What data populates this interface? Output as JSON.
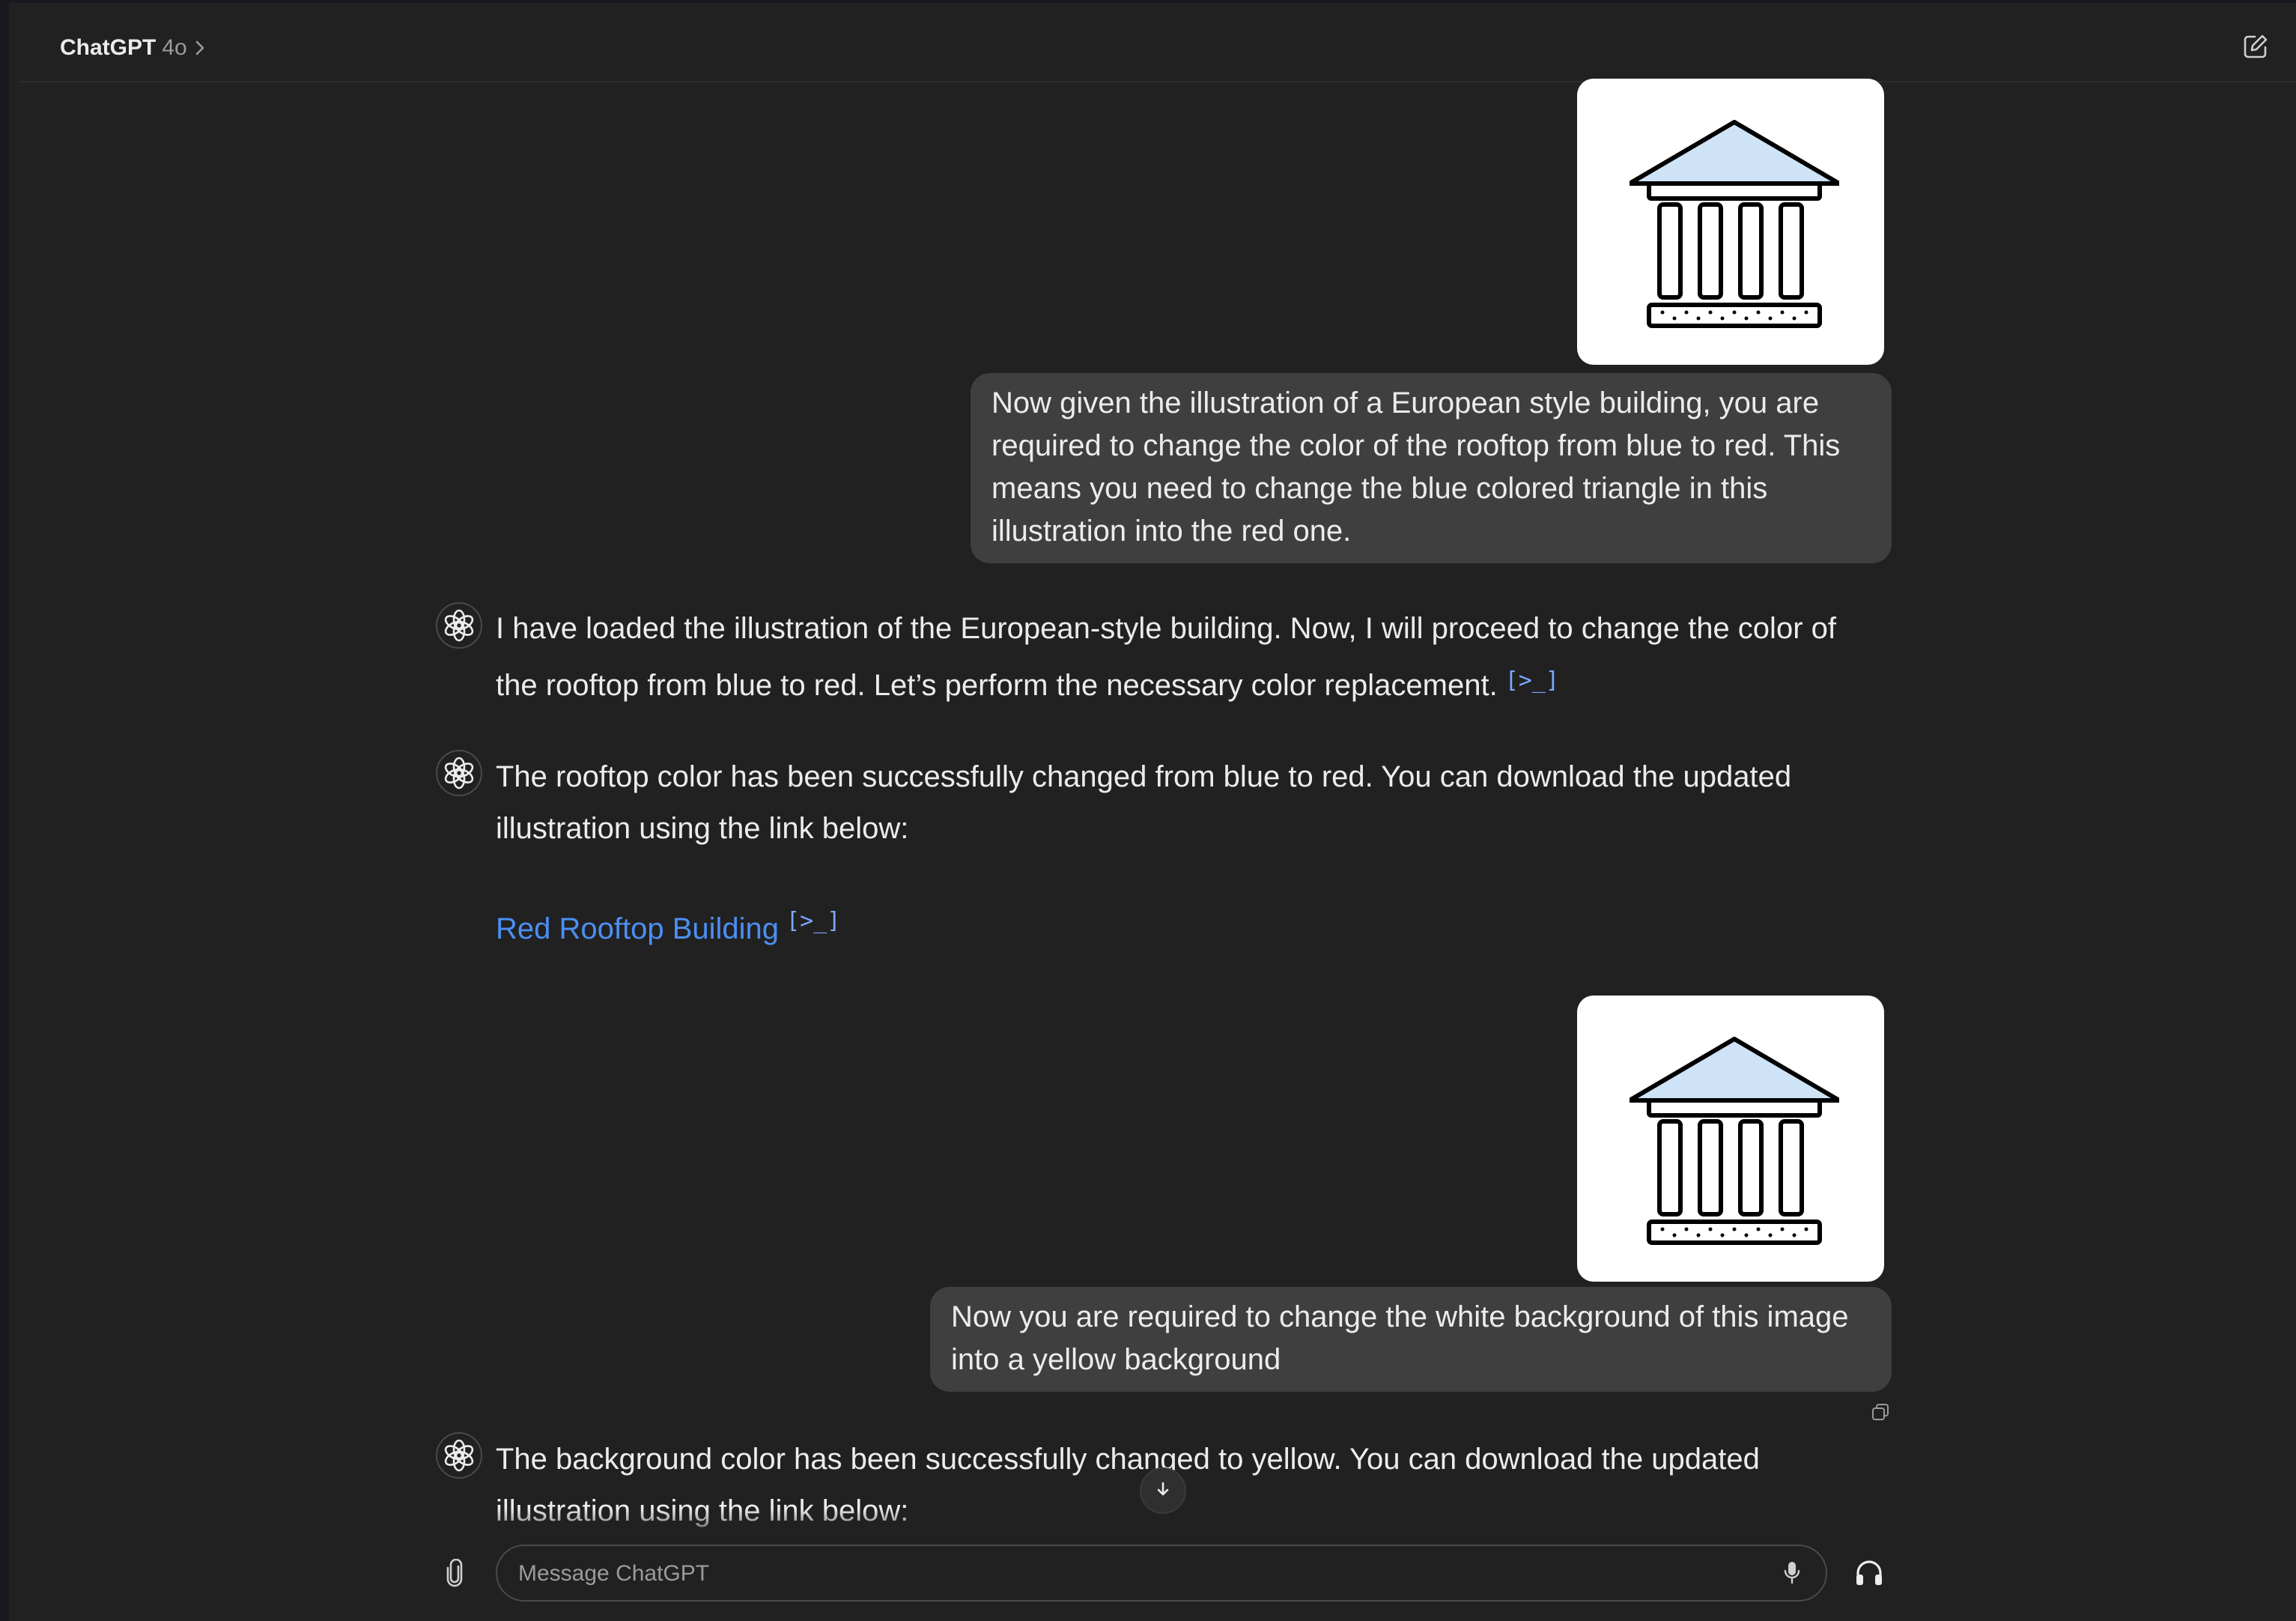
{
  "header": {
    "model_name": "ChatGPT",
    "model_version": "4o",
    "chevron_icon": "chevron-right-icon",
    "new_chat_icon": "edit-icon"
  },
  "colors": {
    "background": "#212121",
    "user_bubble": "#3f3f3f",
    "link": "#4c8ff3",
    "citation": "#7aa7ff",
    "roof_fill": "#cfe3f7"
  },
  "messages": [
    {
      "role": "user",
      "image": "european-building-illustration",
      "text": "Now given the illustration of a European style building, you are required to change the color of the rooftop from blue to red. This means you need to change the blue colored triangle in this illustration into the red one."
    },
    {
      "role": "assistant",
      "text": "I have loaded the illustration of the European-style building. Now, I will proceed to change the color of the rooftop from blue to red. Let’s perform the necessary color replacement.",
      "citation_icon": "code-citation-icon"
    },
    {
      "role": "assistant",
      "text": "The rooftop color has been successfully changed from blue to red. You can download the updated illustration using the link below:",
      "link_text": "Red Rooftop Building",
      "citation_icon": "code-citation-icon"
    },
    {
      "role": "user",
      "image": "european-building-illustration",
      "text": "Now you are required to change the white background of this image into a yellow background"
    },
    {
      "role": "assistant",
      "text": "The background color has been successfully changed to yellow. You can download the updated illustration using the link below:"
    }
  ],
  "composer": {
    "placeholder": "Message ChatGPT",
    "attach_icon": "paperclip-icon",
    "mic_icon": "microphone-icon",
    "voice_icon": "headphones-icon"
  },
  "scroll_icon": "arrow-down-icon",
  "copy_icon": "copy-icon"
}
